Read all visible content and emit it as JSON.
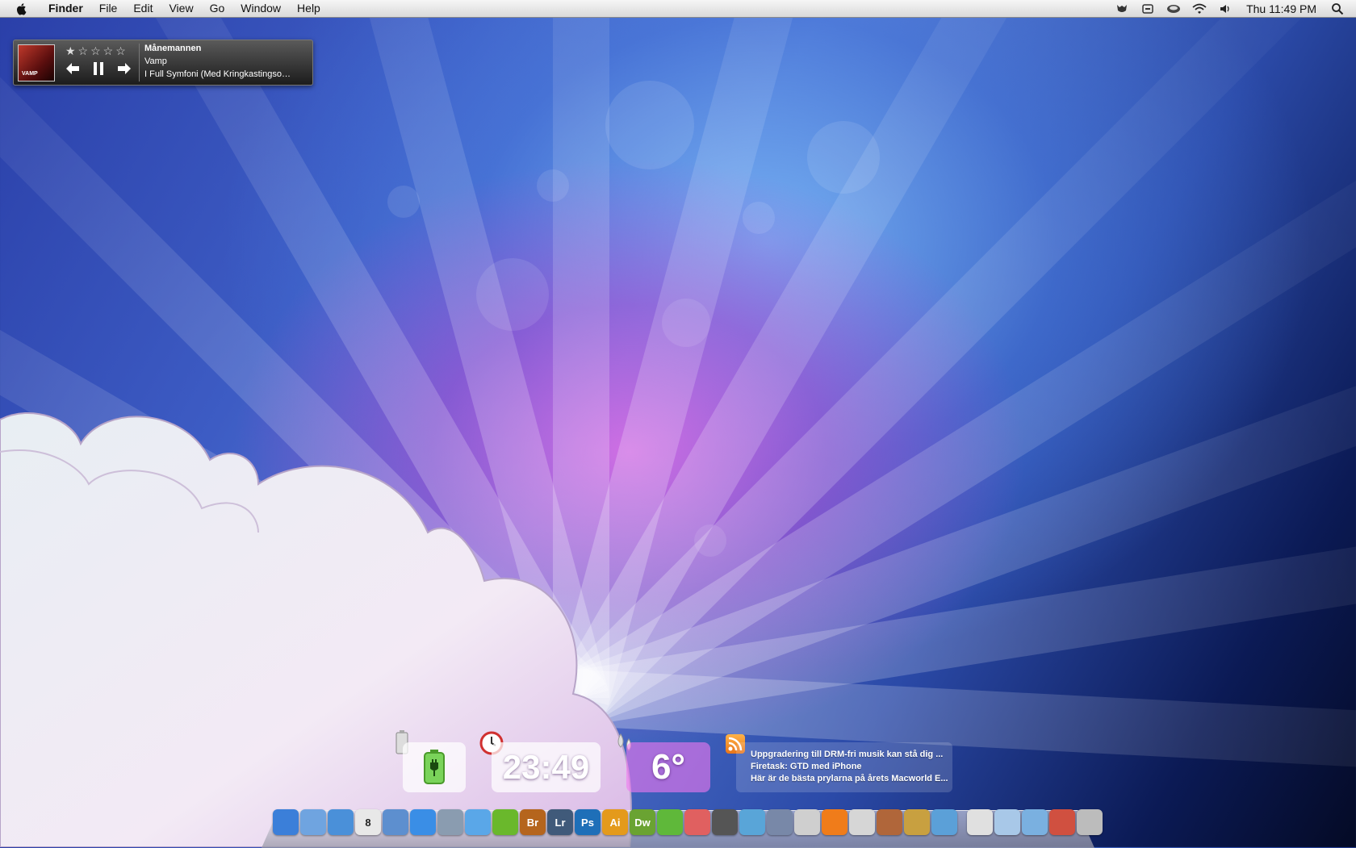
{
  "menubar": {
    "app": "Finder",
    "items": [
      "File",
      "Edit",
      "View",
      "Go",
      "Window",
      "Help"
    ],
    "clock": "Thu 11:49 PM",
    "status_icons": [
      "growl-icon",
      "display-icon",
      "time-machine-icon",
      "wifi-icon",
      "volume-icon",
      "spotlight-icon"
    ]
  },
  "music_widget": {
    "track": "Månemannen",
    "artist": "Vamp",
    "album": "I Full Symfoni (Med Kringkastingso…",
    "album_art_label": "VAMP",
    "rating": 1,
    "rating_max": 5,
    "stars_display": "★☆☆☆☆"
  },
  "widgets": {
    "time": "23:49",
    "temperature": "6°",
    "news": [
      "Uppgradering till DRM-fri musik kan stå dig ...",
      "Firetask: GTD med iPhone",
      "Här är de bästa prylarna på årets Macworld E..."
    ]
  },
  "dock": {
    "apps": [
      {
        "name": "finder-icon",
        "label": "",
        "color": "#3b7fd9"
      },
      {
        "name": "mail-icon",
        "label": "",
        "color": "#6fa4e0"
      },
      {
        "name": "safari-icon",
        "label": "",
        "color": "#4a90d9"
      },
      {
        "name": "ical-icon",
        "label": "8",
        "color": "#e8e8e8"
      },
      {
        "name": "address-book-icon",
        "label": "",
        "color": "#5d8fcf"
      },
      {
        "name": "ichat-icon",
        "label": "",
        "color": "#3a8ee6"
      },
      {
        "name": "preview-icon",
        "label": "",
        "color": "#8a9cb0"
      },
      {
        "name": "itunes-icon",
        "label": "",
        "color": "#5aa7e8"
      },
      {
        "name": "spotify-icon",
        "label": "",
        "color": "#6ab82c"
      },
      {
        "name": "bridge-icon",
        "label": "Br",
        "color": "#b5651d"
      },
      {
        "name": "lightroom-icon",
        "label": "Lr",
        "color": "#405a7a"
      },
      {
        "name": "photoshop-icon",
        "label": "Ps",
        "color": "#1e6fb8"
      },
      {
        "name": "illustrator-icon",
        "label": "Ai",
        "color": "#e49a1b"
      },
      {
        "name": "dreamweaver-icon",
        "label": "Dw",
        "color": "#6aa332"
      },
      {
        "name": "leaf-icon",
        "label": "",
        "color": "#5fb83a"
      },
      {
        "name": "css-edit-icon",
        "label": "",
        "color": "#e06060"
      },
      {
        "name": "photo-booth-icon",
        "label": "",
        "color": "#555555"
      },
      {
        "name": "wordpress-icon",
        "label": "",
        "color": "#59a5d8"
      },
      {
        "name": "script-editor-icon",
        "label": "",
        "color": "#7888a8"
      },
      {
        "name": "ipod-icon",
        "label": "",
        "color": "#cfcfcf"
      },
      {
        "name": "vlc-icon",
        "label": "",
        "color": "#f07c1a"
      },
      {
        "name": "textedit-icon",
        "label": "",
        "color": "#d6d6d6"
      },
      {
        "name": "keynote-icon",
        "label": "",
        "color": "#b0663a"
      },
      {
        "name": "transmit-icon",
        "label": "",
        "color": "#c8a040"
      },
      {
        "name": "system-prefs-icon",
        "label": "",
        "color": "#5ba0d8"
      }
    ],
    "stacks": [
      {
        "name": "documents-stack-icon",
        "color": "#e0e0e0"
      },
      {
        "name": "downloads-stack-icon",
        "color": "#a8c8e8"
      },
      {
        "name": "applications-stack-icon",
        "color": "#7ab0e0"
      },
      {
        "name": "stack-icon",
        "color": "#d05040"
      },
      {
        "name": "trash-icon",
        "color": "#bcbcbc"
      }
    ]
  }
}
